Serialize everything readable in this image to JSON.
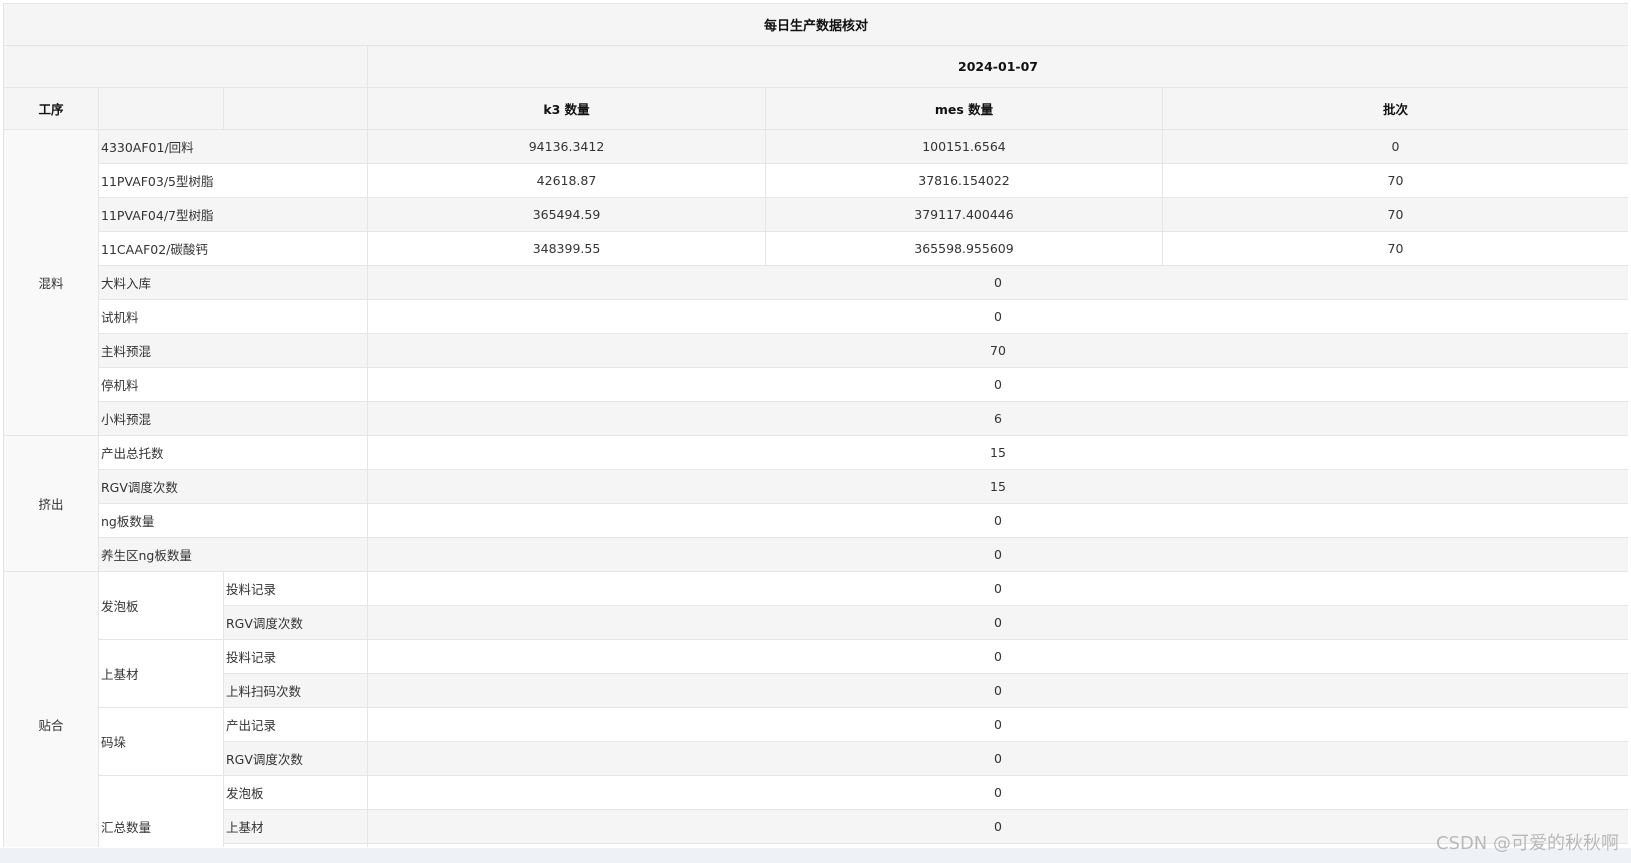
{
  "title": "每日生产数据核对",
  "date": "2024-01-07",
  "header": {
    "process": "工序",
    "k3": "k3 数量",
    "mes": "mes 数量",
    "batch": "批次"
  },
  "mixing": {
    "label": "混料",
    "materials": [
      {
        "name": "4330AF01/回料",
        "k3": "94136.3412",
        "mes": "100151.6564",
        "batch": "0"
      },
      {
        "name": "11PVAF03/5型树脂",
        "k3": "42618.87",
        "mes": "37816.154022",
        "batch": "70"
      },
      {
        "name": "11PVAF04/7型树脂",
        "k3": "365494.59",
        "mes": "379117.400446",
        "batch": "70"
      },
      {
        "name": "11CAAF02/碳酸钙",
        "k3": "348399.55",
        "mes": "365598.955609",
        "batch": "70"
      }
    ],
    "items": [
      {
        "name": "大料入库",
        "value": "0"
      },
      {
        "name": "试机料",
        "value": "0"
      },
      {
        "name": "主料预混",
        "value": "70"
      },
      {
        "name": "停机料",
        "value": "0"
      },
      {
        "name": "小料预混",
        "value": "6"
      }
    ]
  },
  "extrusion": {
    "label": "挤出",
    "items": [
      {
        "name": "产出总托数",
        "value": "15"
      },
      {
        "name": "RGV调度次数",
        "value": "15"
      },
      {
        "name": "ng板数量",
        "value": "0"
      },
      {
        "name": "养生区ng板数量",
        "value": "0"
      }
    ]
  },
  "laminating": {
    "label": "贴合",
    "groups": [
      {
        "name": "发泡板",
        "rows": [
          {
            "name": "投料记录",
            "value": "0"
          },
          {
            "name": "RGV调度次数",
            "value": "0"
          }
        ]
      },
      {
        "name": "上基材",
        "rows": [
          {
            "name": "投料记录",
            "value": "0"
          },
          {
            "name": "上料扫码次数",
            "value": "0"
          }
        ]
      },
      {
        "name": "码垛",
        "rows": [
          {
            "name": "产出记录",
            "value": "0"
          },
          {
            "name": "RGV调度次数",
            "value": "0"
          }
        ]
      },
      {
        "name": "汇总数量",
        "rows": [
          {
            "name": "发泡板",
            "value": "0"
          },
          {
            "name": "上基材",
            "value": "0"
          },
          {
            "name": "",
            "value": ""
          }
        ]
      }
    ]
  },
  "watermark": "CSDN @可爱的秋秋啊"
}
